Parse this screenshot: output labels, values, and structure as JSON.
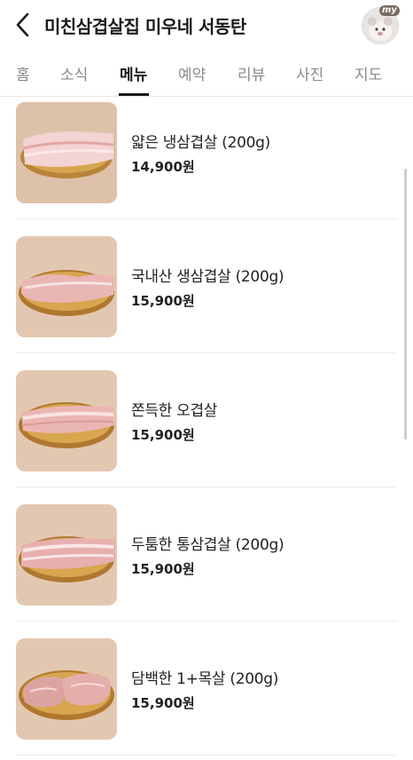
{
  "header": {
    "title": "미친삼겹살집 미우네 서동탄",
    "back_icon": "chevron-left-icon",
    "avatar_badge": "my"
  },
  "tabs": [
    {
      "label": "홈",
      "active": false
    },
    {
      "label": "소식",
      "active": false
    },
    {
      "label": "메뉴",
      "active": true
    },
    {
      "label": "예약",
      "active": false
    },
    {
      "label": "리뷰",
      "active": false
    },
    {
      "label": "사진",
      "active": false
    },
    {
      "label": "지도",
      "active": false
    }
  ],
  "menu": [
    {
      "name": "얇은 냉삼겹살 (200g)",
      "price": "14,900원"
    },
    {
      "name": "국내산 생삼겹살 (200g)",
      "price": "15,900원"
    },
    {
      "name": "쫀득한 오겹살",
      "price": "15,900원"
    },
    {
      "name": "두툼한 통삼겹살 (200g)",
      "price": "15,900원"
    },
    {
      "name": "담백한 1+목살 (200g)",
      "price": "15,900원"
    }
  ],
  "colors": {
    "text_primary": "#1a1a1a",
    "text_muted": "#8a8a8a",
    "divider": "#ececec",
    "plate_gold": "#c9963f",
    "meat_pink": "#e9b3b0"
  }
}
